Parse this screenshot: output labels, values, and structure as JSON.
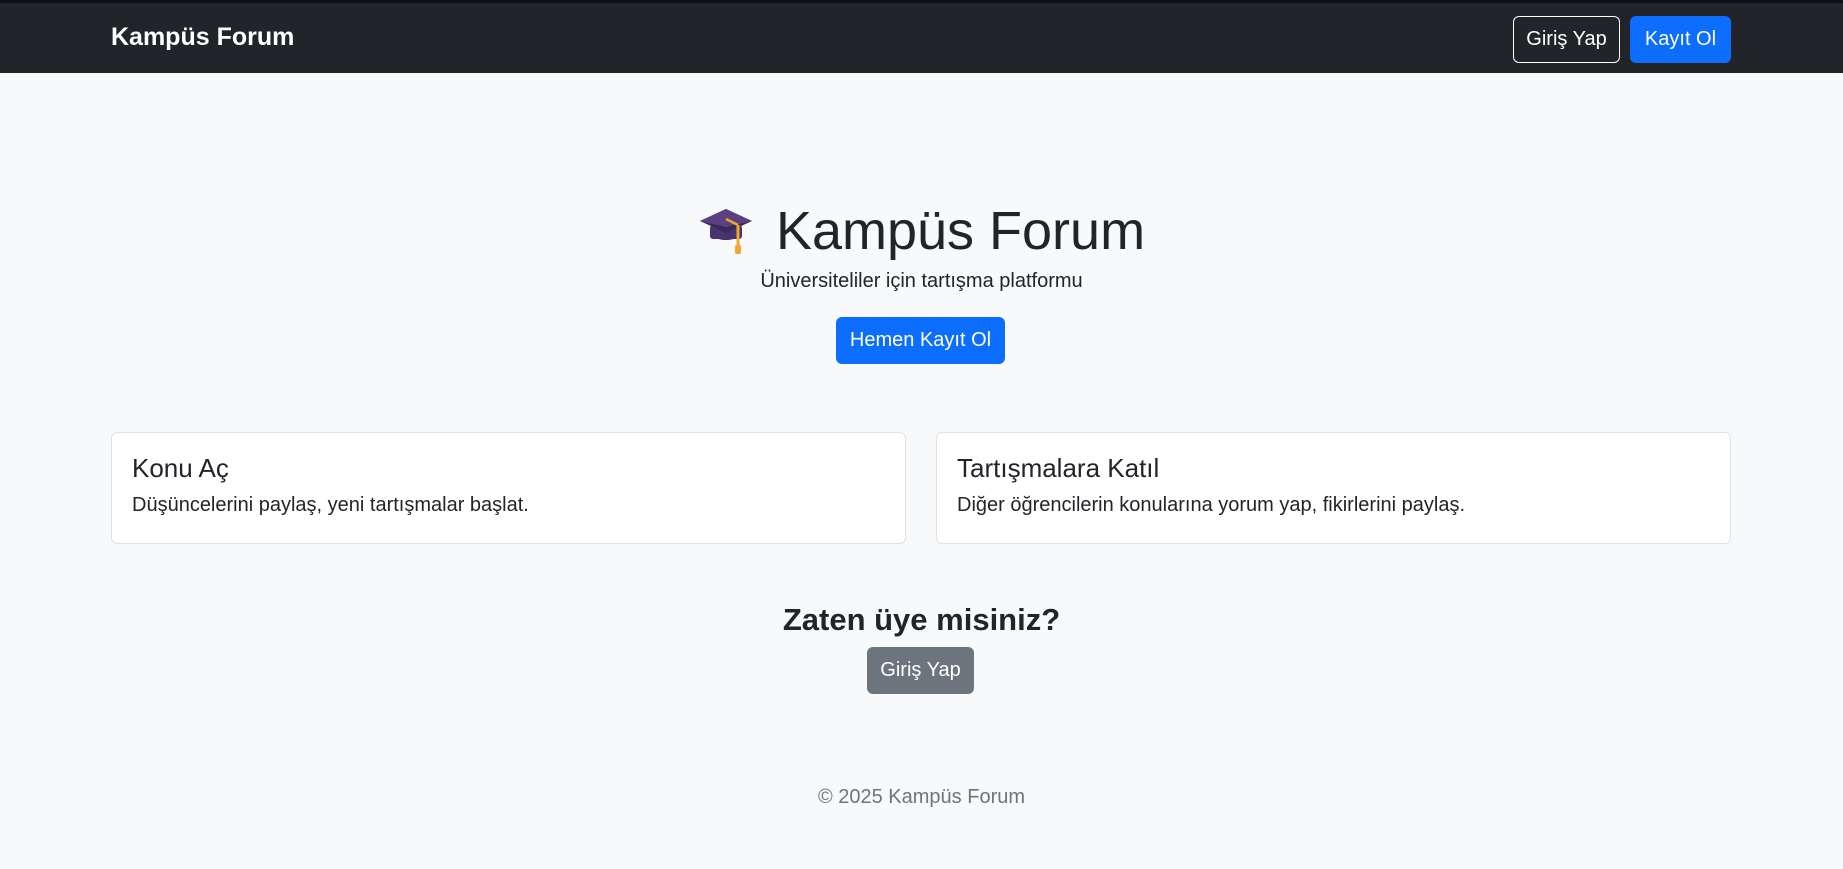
{
  "navbar": {
    "brand": "Kampüs Forum",
    "login_label": "Giriş Yap",
    "register_label": "Kayıt Ol"
  },
  "hero": {
    "icon": "graduation-cap-icon",
    "title": "Kampüs Forum",
    "subtitle": "Üniversiteliler için tartışma platformu",
    "cta_label": "Hemen Kayıt Ol"
  },
  "features": [
    {
      "title": "Konu Aç",
      "text": "Düşüncelerini paylaş, yeni tartışmalar başlat."
    },
    {
      "title": "Tartışmalara Katıl",
      "text": "Diğer öğrencilerin konularına yorum yap, fikirlerini paylaş."
    }
  ],
  "member": {
    "question": "Zaten üye misiniz?",
    "login_label": "Giriş Yap"
  },
  "footer": {
    "text": "© 2025 Kampüs Forum"
  },
  "colors": {
    "navbar_bg": "#212529",
    "primary": "#0d6efd",
    "secondary": "#6c757d",
    "page_bg": "#f8f9fa"
  }
}
